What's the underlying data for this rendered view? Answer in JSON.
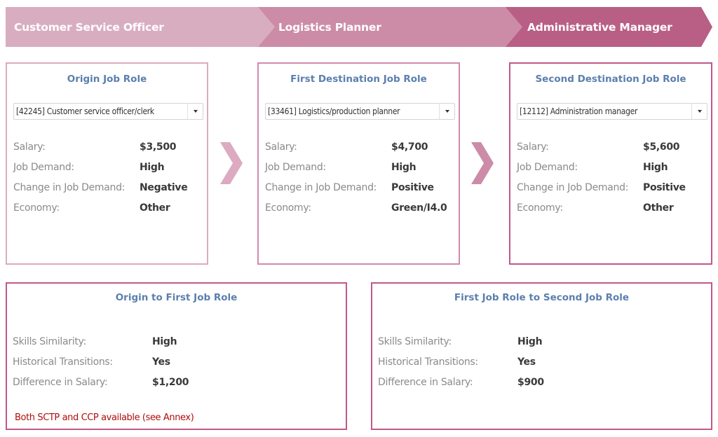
{
  "header": {
    "steps": [
      {
        "label": "Customer Service Officer",
        "color": "#d9adc0"
      },
      {
        "label": "Logistics Planner",
        "color": "#cc8ca7"
      },
      {
        "label": "Administrative Manager",
        "color": "#b95f86"
      }
    ]
  },
  "roles": [
    {
      "title": "Origin Job Role",
      "selected": "[42245] Customer service officer/clerk",
      "fields": [
        {
          "label": "Salary:",
          "value": "$3,500"
        },
        {
          "label": "Job Demand:",
          "value": "High"
        },
        {
          "label": "Change in Job Demand:",
          "value": "Negative"
        },
        {
          "label": "Economy:",
          "value": "Other"
        }
      ]
    },
    {
      "title": "First Destination Job Role",
      "selected": "[33461] Logistics/production planner",
      "fields": [
        {
          "label": "Salary:",
          "value": "$4,700"
        },
        {
          "label": "Job Demand:",
          "value": "High"
        },
        {
          "label": "Change in Job Demand:",
          "value": "Positive"
        },
        {
          "label": "Economy:",
          "value": "Green/I4.0"
        }
      ]
    },
    {
      "title": "Second Destination Job Role",
      "selected": "[12112] Administration manager",
      "fields": [
        {
          "label": "Salary:",
          "value": "$5,600"
        },
        {
          "label": "Job Demand:",
          "value": "High"
        },
        {
          "label": "Change in Job Demand:",
          "value": "Positive"
        },
        {
          "label": "Economy:",
          "value": "Other"
        }
      ]
    }
  ],
  "transitions": [
    {
      "title": "Origin to First Job Role",
      "fields": [
        {
          "label": "Skills Similarity:",
          "value": "High"
        },
        {
          "label": "Historical Transitions:",
          "value": "Yes"
        },
        {
          "label": "Difference in Salary:",
          "value": "$1,200"
        }
      ],
      "note": "Both SCTP and CCP available (see Annex)"
    },
    {
      "title": "First Job Role to Second Job Role",
      "fields": [
        {
          "label": "Skills Similarity:",
          "value": "High"
        },
        {
          "label": "Historical Transitions:",
          "value": "Yes"
        },
        {
          "label": "Difference in Salary:",
          "value": "$900"
        }
      ]
    }
  ],
  "colors": {
    "title_blue": "#5b7fae",
    "note_red": "#b00d0d",
    "arrow1": "#dcaac1",
    "arrow2": "#cc8ca7"
  }
}
